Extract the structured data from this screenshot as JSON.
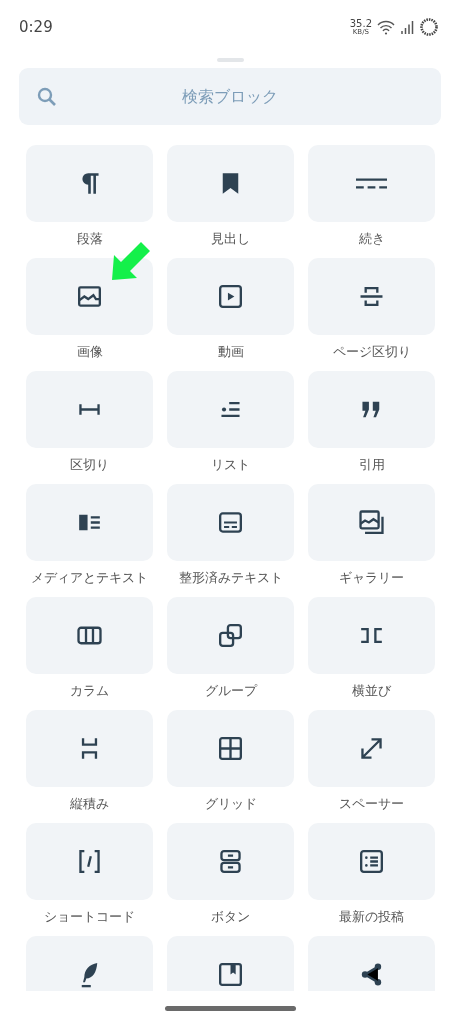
{
  "status_bar": {
    "time": "0:29",
    "speed": "35.2",
    "speed_unit": "KB/S"
  },
  "search": {
    "placeholder": "検索ブロック"
  },
  "blocks": [
    {
      "kind": "paragraph",
      "label": "段落",
      "pointer": false
    },
    {
      "kind": "heading",
      "label": "見出し",
      "pointer": false
    },
    {
      "kind": "more",
      "label": "続き",
      "pointer": false
    },
    {
      "kind": "image",
      "label": "画像",
      "pointer": true
    },
    {
      "kind": "video",
      "label": "動画",
      "pointer": false
    },
    {
      "kind": "pagebreak",
      "label": "ページ区切り",
      "pointer": false
    },
    {
      "kind": "separator",
      "label": "区切り",
      "pointer": false
    },
    {
      "kind": "list",
      "label": "リスト",
      "pointer": false
    },
    {
      "kind": "quote",
      "label": "引用",
      "pointer": false
    },
    {
      "kind": "media-text",
      "label": "メディアとテキスト",
      "pointer": false
    },
    {
      "kind": "preformatted",
      "label": "整形済みテキスト",
      "pointer": false
    },
    {
      "kind": "gallery",
      "label": "ギャラリー",
      "pointer": false
    },
    {
      "kind": "columns",
      "label": "カラム",
      "pointer": false
    },
    {
      "kind": "group",
      "label": "グループ",
      "pointer": false
    },
    {
      "kind": "row",
      "label": "横並び",
      "pointer": false
    },
    {
      "kind": "stack",
      "label": "縦積み",
      "pointer": false
    },
    {
      "kind": "grid",
      "label": "グリッド",
      "pointer": false
    },
    {
      "kind": "spacer",
      "label": "スペーサー",
      "pointer": false
    },
    {
      "kind": "shortcode",
      "label": "ショートコード",
      "pointer": false
    },
    {
      "kind": "buttons",
      "label": "ボタン",
      "pointer": false
    },
    {
      "kind": "latest-posts",
      "label": "最新の投稿",
      "pointer": false
    },
    {
      "kind": "feather",
      "pointer": false
    },
    {
      "kind": "book",
      "pointer": false
    },
    {
      "kind": "share",
      "pointer": false
    }
  ]
}
